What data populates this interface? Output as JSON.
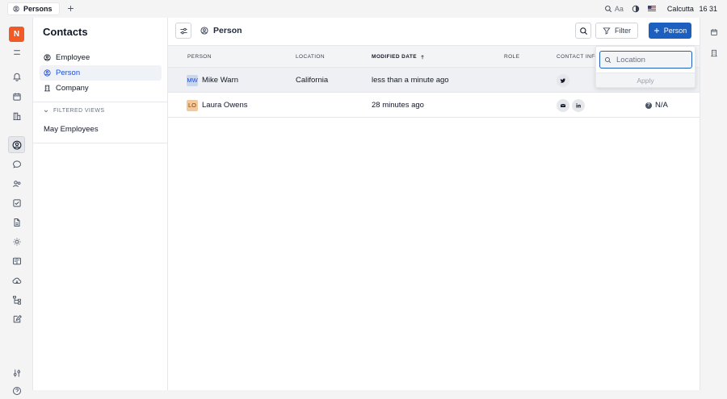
{
  "tabs": [
    {
      "label": "Persons"
    }
  ],
  "topbar": {
    "aa_label": "Aa",
    "clock_city": "Calcutta",
    "clock_time": "16 31"
  },
  "workspace": {
    "logo_letter": "N",
    "logo_color": "#f15a24"
  },
  "sidebar": {
    "title": "Contacts",
    "items": [
      {
        "label": "Employee",
        "icon": "user-circle-icon"
      },
      {
        "label": "Person",
        "icon": "user-circle-icon",
        "active": true
      },
      {
        "label": "Company",
        "icon": "building-icon"
      }
    ],
    "section_title": "FILTERED VIEWS",
    "views": [
      {
        "label": "May Employees"
      }
    ]
  },
  "header": {
    "title": "Person",
    "filter_label": "Filter",
    "add_label": "Person"
  },
  "table": {
    "columns": [
      "PERSON",
      "LOCATION",
      "MODIFIED DATE",
      "ROLE",
      "CONTACT INFO"
    ],
    "rows": [
      {
        "initials": "MW",
        "name": "Mike Warn",
        "location": "California",
        "modified": "less than a minute ago",
        "contacts": [
          "twitter-icon"
        ],
        "extra": ""
      },
      {
        "initials": "LO",
        "name": "Laura Owens",
        "location": "",
        "modified": "28 minutes ago",
        "contacts": [
          "mail-icon",
          "linkedin-icon"
        ],
        "extra": "N/A"
      }
    ]
  },
  "filter_dropdown": {
    "placeholder": "Location",
    "apply_label": "Apply"
  },
  "colors": {
    "accent": "#1d5fbf",
    "avatar_mw_bg": "#c9d6ee",
    "avatar_lo_bg": "#f3c89b"
  }
}
